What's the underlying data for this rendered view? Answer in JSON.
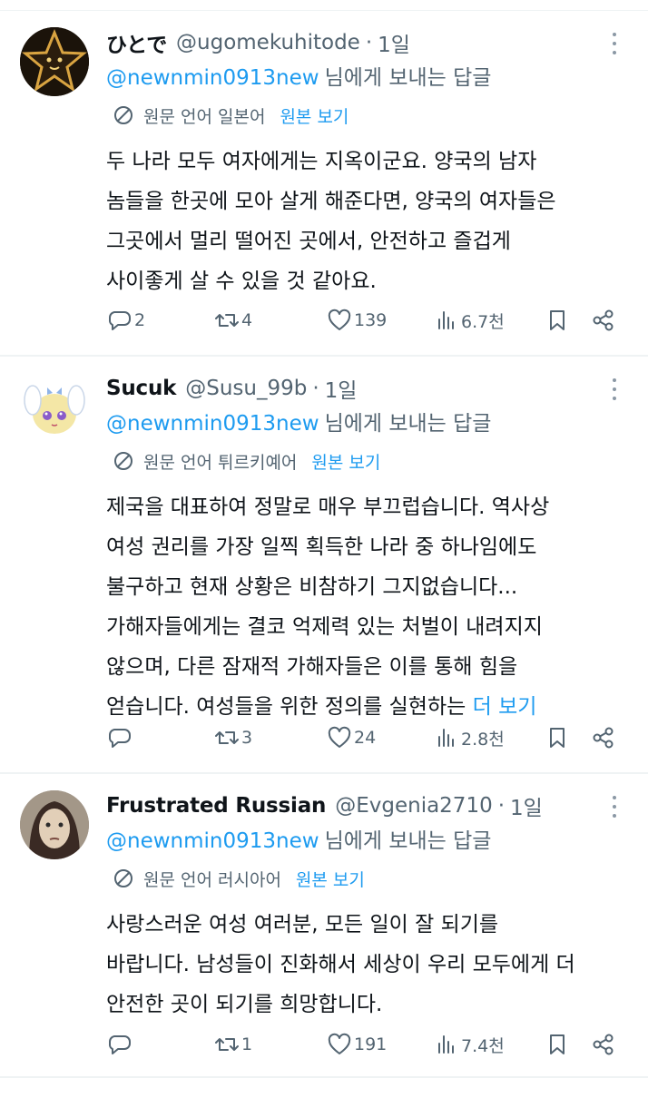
{
  "tweets": [
    {
      "display_name": "ひとで",
      "handle": "@ugomekuhitode",
      "separator": "·",
      "time": "1일",
      "reply_to_mention": "@newnmin0913new",
      "reply_to_suffix": "님에게 보내는 답글",
      "translation_label": "원문 언어 일본어",
      "show_original": "원본 보기",
      "body": [
        "두 나라 모두 여자에게는 지옥이군요. 양국의 남자",
        "놈들을 한곳에 모아 살게 해준다면, 양국의 여자들은",
        "그곳에서 멀리 떨어진 곳에서, 안전하고 즐겁게",
        "사이좋게 살 수 있을 것 같아요."
      ],
      "more": "",
      "replies": "2",
      "retweets": "4",
      "likes": "139",
      "views": "6.7천"
    },
    {
      "display_name": "Sucuk",
      "handle": "@Susu_99b",
      "separator": "·",
      "time": "1일",
      "reply_to_mention": "@newnmin0913new",
      "reply_to_suffix": "님에게 보내는 답글",
      "translation_label": "원문 언어 튀르키예어",
      "show_original": "원본 보기",
      "body": [
        "제국을 대표하여 정말로 매우 부끄럽습니다. 역사상",
        "여성 권리를 가장 일찍 획득한 나라 중 하나임에도",
        "불구하고 현재 상황은 비참하기 그지없습니다...",
        "가해자들에게는 결코 억제력 있는 처벌이 내려지지",
        "않으며, 다른 잠재적 가해자들은 이를 통해 힘을",
        "얻습니다. 여성들을 위한 정의를 실현하는"
      ],
      "more": "더 보기",
      "replies": "",
      "retweets": "3",
      "likes": "24",
      "views": "2.8천"
    },
    {
      "display_name": "Frustrated Russian",
      "handle": "@Evgenia2710",
      "separator": "·",
      "time": "1일",
      "reply_to_mention": "@newnmin0913new",
      "reply_to_suffix": "님에게 보내는 답글",
      "translation_label": "원문 언어 러시아어",
      "show_original": "원본 보기",
      "body": [
        "사랑스러운 여성 여러분, 모든 일이 잘 되기를",
        "바랍니다. 남성들이 진화해서 세상이 우리 모두에게 더",
        "안전한 곳이 되기를 희망합니다."
      ],
      "more": "",
      "replies": "",
      "retweets": "1",
      "likes": "191",
      "views": "7.4천"
    }
  ],
  "colors": {
    "accent": "#1d9bf0",
    "secondary_text": "#536471",
    "primary_text": "#0f1419",
    "divider": "#eff3f4"
  }
}
